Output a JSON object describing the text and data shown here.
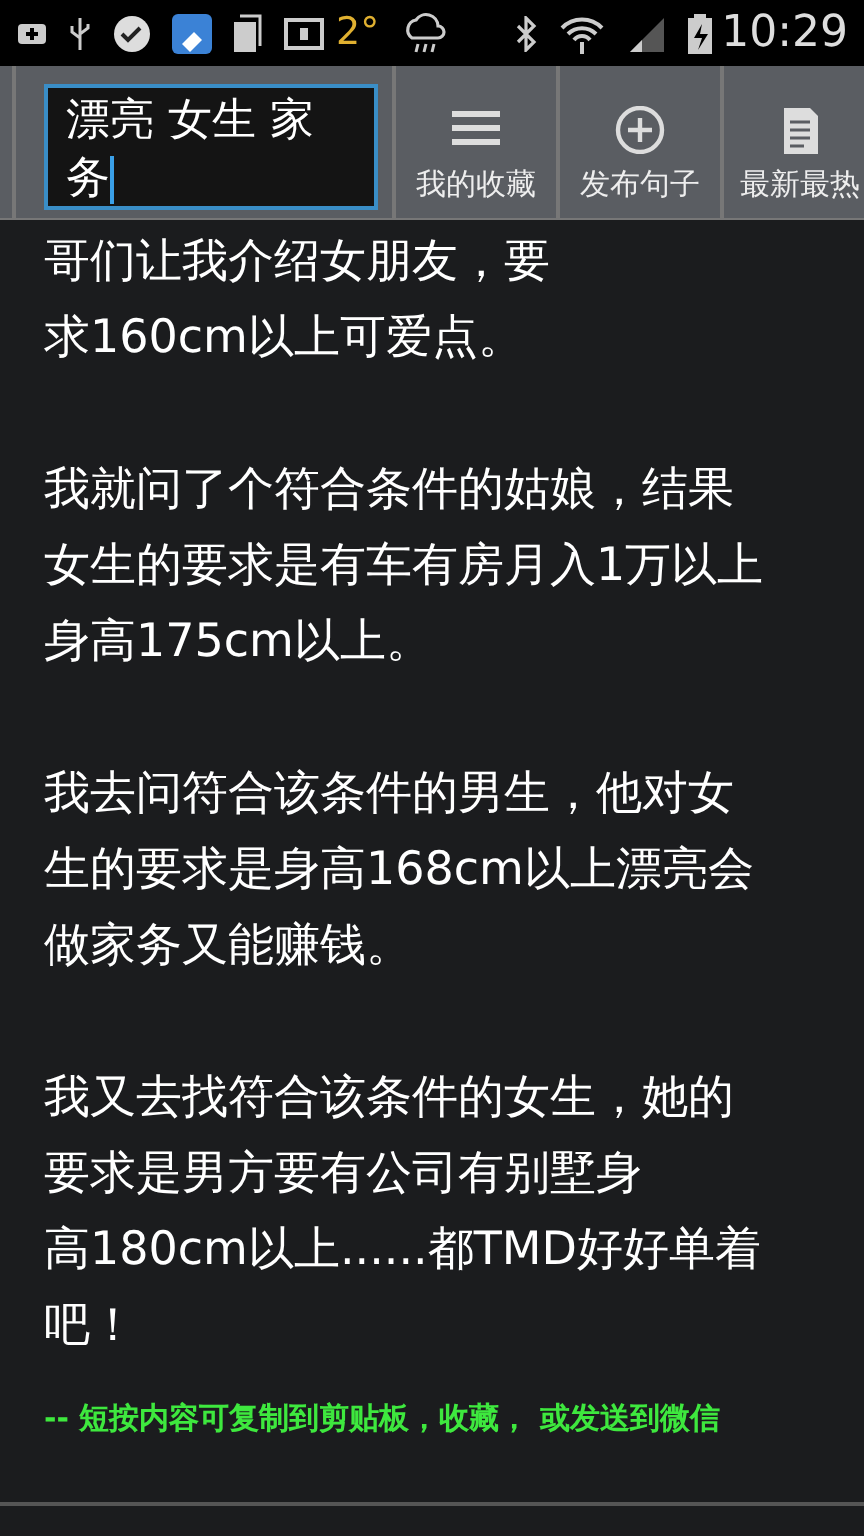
{
  "status_bar": {
    "temperature": "2°",
    "time": "10:29"
  },
  "toolbar": {
    "search": {
      "value": "漂亮 女生 家务"
    },
    "buttons": [
      {
        "kind": "menu",
        "label": "我的收藏"
      },
      {
        "kind": "add",
        "label": "发布句子"
      },
      {
        "kind": "document",
        "label": "最新最热"
      }
    ]
  },
  "posts": [
    {
      "paragraphs": [
        [
          "哥们让我介绍女朋友，要",
          "求160cm以上可爱点。"
        ],
        [
          "我就问了个符合条件的姑娘，结果",
          "女生的要求是有车有房月入1万以上",
          "身高175cm以上。"
        ],
        [
          "我去问符合该条件的男生，他对女",
          "生的要求是身高168cm以上漂亮会",
          "做家务又能赚钱。"
        ],
        [
          "我又去找符合该条件的女生，她的",
          "要求是男方要有公司有别墅身",
          "高180cm以上......都TMD好好单着",
          "吧！"
        ]
      ],
      "hint": "-- 短按内容可复制到剪贴板，收藏， 或发送到微信"
    }
  ]
}
